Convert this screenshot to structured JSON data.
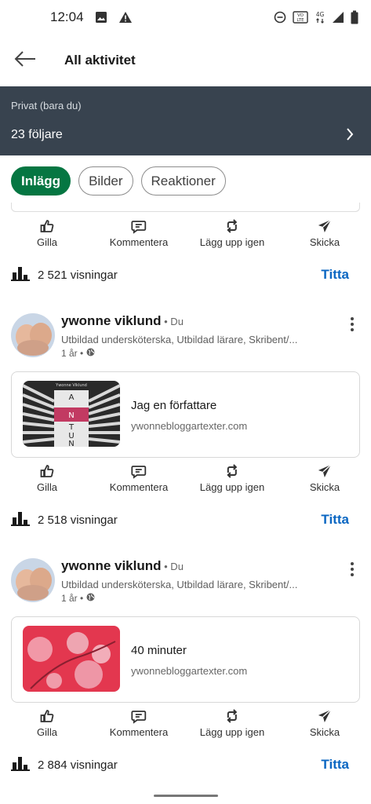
{
  "status_bar": {
    "time": "12:04",
    "left_icons": [
      "image-icon",
      "warning-icon"
    ],
    "right_icons": [
      "do-not-disturb-icon",
      "volte-icon",
      "4g-icon",
      "signal-icon",
      "battery-icon"
    ],
    "volte_text": "VO LTE",
    "network_text": "4G"
  },
  "header": {
    "title": "All aktivitet",
    "back_icon": "arrow-left-icon"
  },
  "banner": {
    "privacy": "Privat (bara du)",
    "followers": "23 följare",
    "chevron_icon": "chevron-right-icon",
    "background": "#38434f"
  },
  "filters": [
    {
      "label": "Inlägg",
      "active": true
    },
    {
      "label": "Bilder",
      "active": false
    },
    {
      "label": "Reaktioner",
      "active": false
    }
  ],
  "actions": {
    "like": "Gilla",
    "comment": "Kommentera",
    "repost": "Lägg upp igen",
    "send": "Skicka"
  },
  "stats": [
    {
      "views": "2 521 visningar",
      "link": "Titta"
    },
    {
      "views": "2 518 visningar",
      "link": "Titta"
    },
    {
      "views": "2 884 visningar",
      "link": "Titta"
    }
  ],
  "posts": [
    {
      "author": "ywonne viklund",
      "relation": " • Du",
      "headline": "Utbildad undersköterska, Utbildad lärare, Skribent/...",
      "time": "1 år •",
      "card_title": "Jag en författare",
      "card_domain": "ywonnebloggartexter.com",
      "thumb_caption": "Ywonne Viklund",
      "thumb_letters": [
        "A",
        "N",
        "T",
        "U",
        "N"
      ]
    },
    {
      "author": "ywonne viklund",
      "relation": " • Du",
      "headline": "Utbildad undersköterska, Utbildad lärare, Skribent/...",
      "time": "1 år •",
      "card_title": "40 minuter",
      "card_domain": "ywonnebloggartexter.com"
    }
  ],
  "colors": {
    "accent_green": "#057642",
    "link_blue": "#0a66c2",
    "banner_dark": "#38434f"
  }
}
